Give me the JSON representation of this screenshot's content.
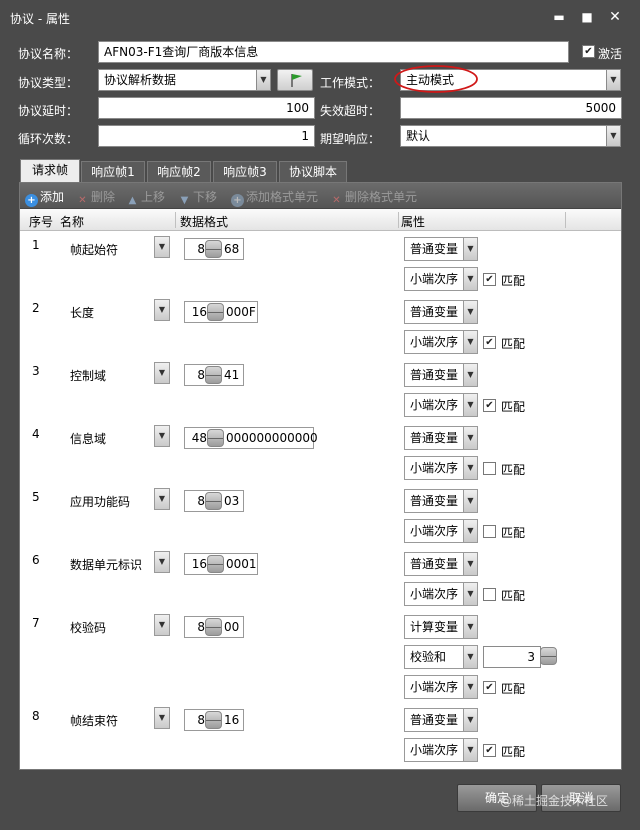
{
  "window": {
    "title": "协议 - 属性"
  },
  "form": {
    "name_label": "协议名称：",
    "name_value": "AFN03-F1查询厂商版本信息",
    "activate_label": "激活",
    "activate_checked": true,
    "type_label": "协议类型：",
    "type_value": "协议解析数据",
    "mode_label": "工作模式：",
    "mode_value": "主动模式",
    "delay_label": "协议延时：",
    "delay_value": "100",
    "timeout_label": "失效超时：",
    "timeout_value": "5000",
    "loop_label": "循环次数：",
    "loop_value": "1",
    "expect_label": "期望响应：",
    "expect_value": "默认"
  },
  "tabs": [
    "请求帧",
    "响应帧1",
    "响应帧2",
    "响应帧3",
    "协议脚本"
  ],
  "toolbar": {
    "add": "添加",
    "delete": "删除",
    "up": "上移",
    "down": "下移",
    "add_fmt": "添加格式单元",
    "del_fmt": "删除格式单元"
  },
  "table": {
    "headers": {
      "seq": "序号",
      "name": "名称",
      "format": "数据格式",
      "attr": "属性"
    },
    "rows": [
      {
        "seq": "1",
        "name": "帧起始符",
        "bits": "8",
        "hex": "68",
        "var": "普通变量",
        "order": "小端次序",
        "match": "匹配",
        "matched": true
      },
      {
        "seq": "2",
        "name": "长度",
        "bits": "16",
        "hex": "000F",
        "var": "普通变量",
        "order": "小端次序",
        "match": "匹配",
        "matched": true
      },
      {
        "seq": "3",
        "name": "控制域",
        "bits": "8",
        "hex": "41",
        "var": "普通变量",
        "order": "小端次序",
        "match": "匹配",
        "matched": true
      },
      {
        "seq": "4",
        "name": "信息域",
        "bits": "48",
        "hex": "000000000000",
        "var": "普通变量",
        "order": "小端次序",
        "match": "匹配",
        "matched": false
      },
      {
        "seq": "5",
        "name": "应用功能码",
        "bits": "8",
        "hex": "03",
        "var": "普通变量",
        "order": "小端次序",
        "match": "匹配",
        "matched": false
      },
      {
        "seq": "6",
        "name": "数据单元标识",
        "bits": "16",
        "hex": "0001",
        "var": "普通变量",
        "order": "小端次序",
        "match": "匹配",
        "matched": false
      },
      {
        "seq": "7",
        "name": "校验码",
        "bits": "8",
        "hex": "00",
        "var": "计算变量",
        "calc": "校验和",
        "calc_num": "3",
        "order": "小端次序",
        "match": "匹配",
        "matched": true
      },
      {
        "seq": "8",
        "name": "帧结束符",
        "bits": "8",
        "hex": "16",
        "var": "普通变量",
        "order": "小端次序",
        "match": "匹配",
        "matched": true
      }
    ]
  },
  "buttons": {
    "ok": "确定",
    "cancel": "取消"
  },
  "watermark": "@稀土掘金技术社区",
  "colors": {
    "highlight_ellipse": "#d01818",
    "add_icon": "#3b8fe0",
    "flag": "#2c9a2c"
  }
}
